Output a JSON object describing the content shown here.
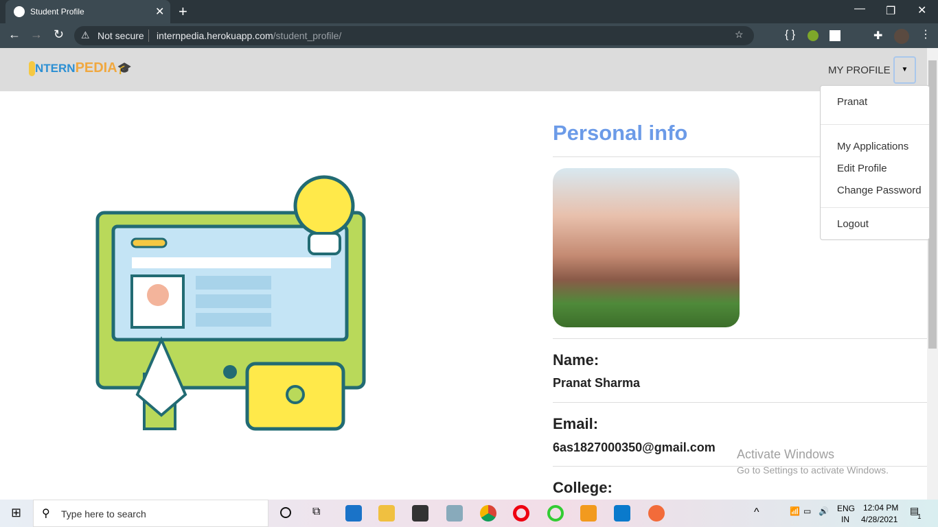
{
  "browser": {
    "tab_title": "Student Profile",
    "security": "Not secure",
    "url_host": "internpedia.herokuapp.com",
    "url_path": "/student_profile/"
  },
  "navbar": {
    "logo_text_a": "NTERN",
    "logo_text_b": "PEDIA",
    "profile_label": "MY PROFILE"
  },
  "dropdown": {
    "user": "Pranat",
    "items": [
      "My Applications",
      "Edit Profile",
      "Change Password"
    ],
    "logout": "Logout"
  },
  "profile": {
    "section_title": "Personal info",
    "fields": [
      {
        "label": "Name:",
        "value": "Pranat Sharma"
      },
      {
        "label": "Email:",
        "value": "6as1827000350@gmail.com"
      },
      {
        "label": "College:",
        "value": ""
      }
    ]
  },
  "watermark": {
    "title": "Activate Windows",
    "subtitle": "Go to Settings to activate Windows."
  },
  "taskbar": {
    "search_placeholder": "Type here to search",
    "lang": "ENG",
    "region": "IN",
    "time": "12:04 PM",
    "date": "4/28/2021",
    "notifications": "1"
  },
  "colors": {
    "accent": "#6c9be8"
  }
}
